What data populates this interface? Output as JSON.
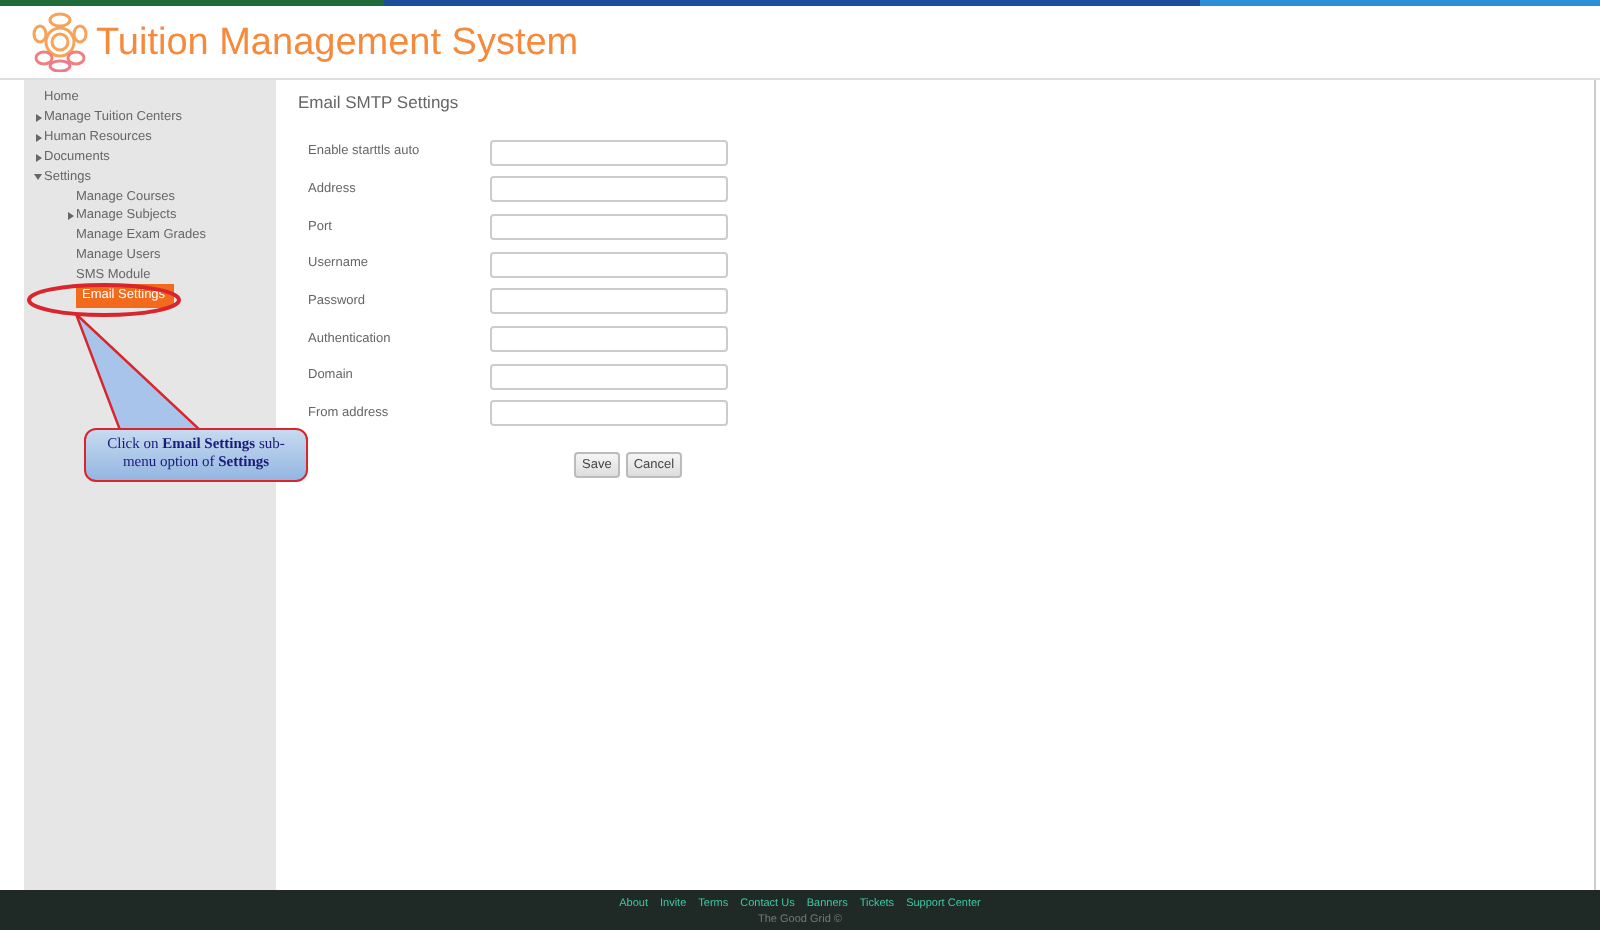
{
  "header": {
    "title": "Tuition Management System"
  },
  "sidebar": {
    "items": [
      {
        "label": "Home",
        "selected": false
      },
      {
        "label": "Manage Tuition Centers",
        "selected": false,
        "expanded": false
      },
      {
        "label": "Human Resources",
        "selected": false,
        "expanded": false
      },
      {
        "label": "Documents",
        "selected": false,
        "expanded": false
      },
      {
        "label": "Settings",
        "selected": false,
        "expanded": true,
        "children": [
          {
            "label": "Manage Courses",
            "selected": false
          },
          {
            "label": "Manage Subjects",
            "selected": false,
            "expanded": false
          },
          {
            "label": "Manage Exam Grades",
            "selected": false
          },
          {
            "label": "Manage Users",
            "selected": false
          },
          {
            "label": "SMS Module",
            "selected": false
          },
          {
            "label": "Email Settings",
            "selected": true
          }
        ]
      }
    ]
  },
  "page": {
    "title": "Email SMTP Settings",
    "fields": [
      {
        "label": "Enable starttls auto"
      },
      {
        "label": "Address"
      },
      {
        "label": "Port"
      },
      {
        "label": "Username"
      },
      {
        "label": "Password"
      },
      {
        "label": "Authentication"
      },
      {
        "label": "Domain"
      },
      {
        "label": "From address"
      }
    ],
    "buttons": [
      "Save",
      "Cancel"
    ]
  },
  "callout": {
    "text": "Click on **Email Settings** sub-menu option of  **Settings**"
  },
  "footer": {
    "links": [
      "About",
      "Invite",
      "Terms",
      "Contact Us",
      "Banners",
      "Tickets",
      "Support Center"
    ],
    "copyright": "The Good Grid ©"
  }
}
